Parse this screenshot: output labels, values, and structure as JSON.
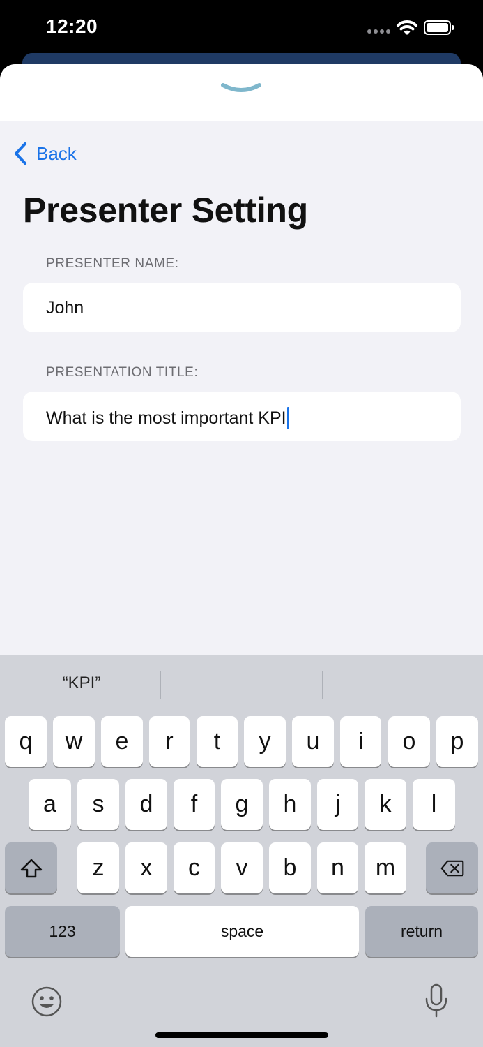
{
  "status_bar": {
    "time": "12:20"
  },
  "nav": {
    "back_label": "Back"
  },
  "page": {
    "title": "Presenter Setting"
  },
  "form": {
    "presenter_name_label": "PRESENTER NAME:",
    "presenter_name_value": "John",
    "presentation_title_label": "PRESENTATION TITLE:",
    "presentation_title_value": "What is the most important KPI"
  },
  "keyboard": {
    "suggestions": [
      "“KPI”",
      "",
      ""
    ],
    "row1": [
      "q",
      "w",
      "e",
      "r",
      "t",
      "y",
      "u",
      "i",
      "o",
      "p"
    ],
    "row2": [
      "a",
      "s",
      "d",
      "f",
      "g",
      "h",
      "j",
      "k",
      "l"
    ],
    "row3": [
      "z",
      "x",
      "c",
      "v",
      "b",
      "n",
      "m"
    ],
    "numbers_label": "123",
    "space_label": "space",
    "return_label": "return"
  },
  "icons": {
    "grabber": "chevron-down-icon",
    "back": "chevron-left-icon",
    "shift": "shift-icon",
    "delete": "delete-icon",
    "emoji": "emoji-icon",
    "mic": "mic-icon",
    "wifi": "wifi-icon",
    "battery": "battery-icon"
  },
  "colors": {
    "accent": "#1a73e8",
    "background": "#f2f2f7",
    "grabber": "#7fb7cc"
  }
}
